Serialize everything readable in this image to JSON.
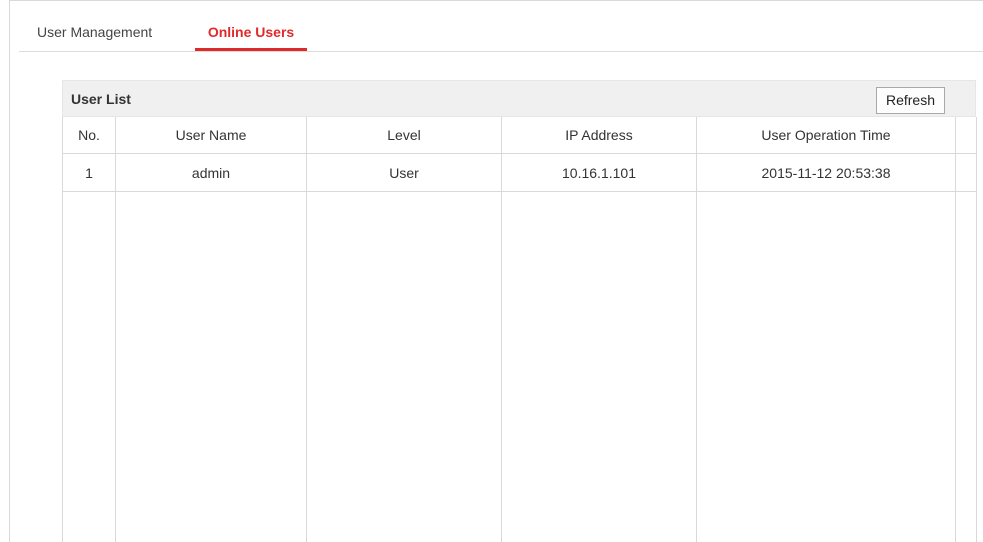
{
  "tabs": [
    {
      "label": "User Management",
      "active": false
    },
    {
      "label": "Online Users",
      "active": true
    }
  ],
  "user_list": {
    "title": "User List",
    "refresh_label": "Refresh",
    "columns": [
      "No.",
      "User Name",
      "Level",
      "IP Address",
      "User Operation Time"
    ],
    "rows": [
      {
        "no": "1",
        "user_name": "admin",
        "level": "User",
        "ip_address": "10.16.1.101",
        "operation_time": "2015-11-12 20:53:38"
      }
    ]
  },
  "colors": {
    "accent": "#e02a2a",
    "header_bg": "#f0f0f0",
    "border": "#d9d9d9"
  }
}
